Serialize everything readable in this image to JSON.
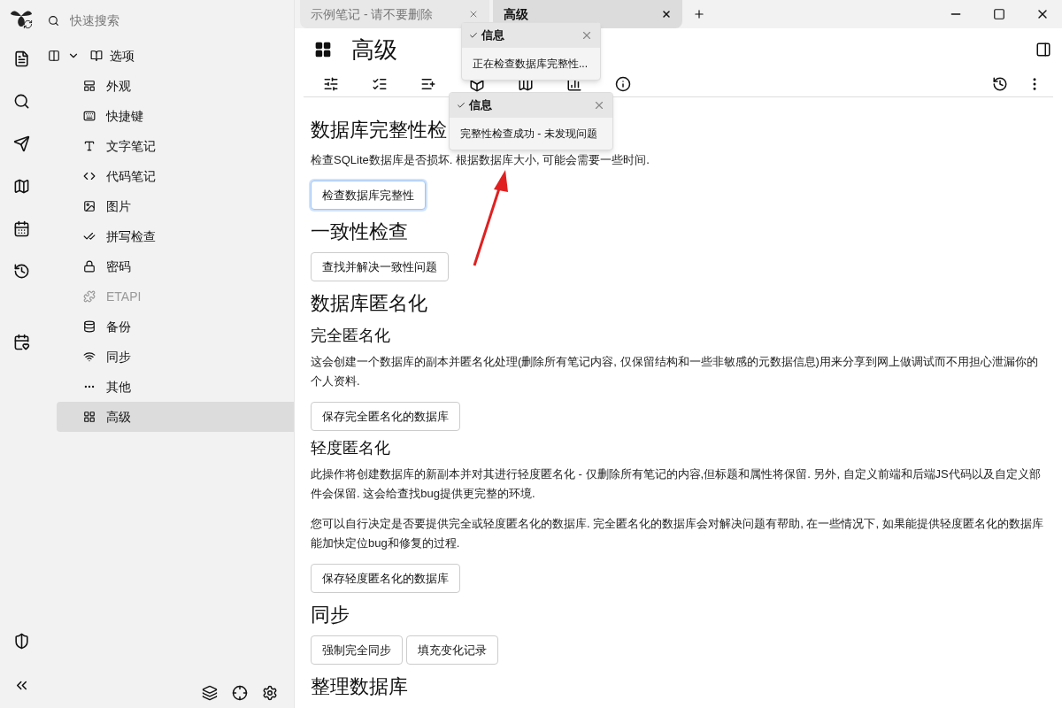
{
  "search": {
    "placeholder": "快速搜索"
  },
  "tree": {
    "label": "选项",
    "expanded": true,
    "children": [
      {
        "label": "外观",
        "selected": false,
        "disabled": false
      },
      {
        "label": "快捷键",
        "selected": false,
        "disabled": false
      },
      {
        "label": "文字笔记",
        "selected": false,
        "disabled": false
      },
      {
        "label": "代码笔记",
        "selected": false,
        "disabled": false
      },
      {
        "label": "图片",
        "selected": false,
        "disabled": false
      },
      {
        "label": "拼写检查",
        "selected": false,
        "disabled": false
      },
      {
        "label": "密码",
        "selected": false,
        "disabled": false
      },
      {
        "label": "ETAPI",
        "selected": false,
        "disabled": true
      },
      {
        "label": "备份",
        "selected": false,
        "disabled": false
      },
      {
        "label": "同步",
        "selected": false,
        "disabled": false
      },
      {
        "label": "其他",
        "selected": false,
        "disabled": false
      },
      {
        "label": "高级",
        "selected": true,
        "disabled": false
      }
    ]
  },
  "tabs": [
    {
      "label": "示例笔记 - 请不要删除",
      "selected": false
    },
    {
      "label": "高级",
      "selected": true
    }
  ],
  "note": {
    "title": "高级"
  },
  "toasts": [
    {
      "title": "信息",
      "message": "正在检查数据库完整性..."
    },
    {
      "title": "信息",
      "message": "完整性检查成功 - 未发现问题"
    }
  ],
  "sections": [
    {
      "kind": "heading",
      "text": "数据库完整性检"
    },
    {
      "kind": "paragraph",
      "text": "检查SQLite数据库是否损坏. 根据数据库大小, 可能会需要一些时间."
    },
    {
      "kind": "buttons",
      "buttons": [
        {
          "label": "检查数据库完整性",
          "focused": true
        }
      ]
    },
    {
      "kind": "heading",
      "text": "一致性检查"
    },
    {
      "kind": "buttons",
      "buttons": [
        {
          "label": "查找并解决一致性问题",
          "focused": false
        }
      ]
    },
    {
      "kind": "heading",
      "text": "数据库匿名化"
    },
    {
      "kind": "subheading",
      "text": "完全匿名化"
    },
    {
      "kind": "paragraph",
      "text": "这会创建一个数据库的副本并匿名化处理(删除所有笔记内容, 仅保留结构和一些非敏感的元数据信息)用来分享到网上做调试而不用担心泄漏你的个人资料."
    },
    {
      "kind": "buttons",
      "buttons": [
        {
          "label": "保存完全匿名化的数据库",
          "focused": false
        }
      ]
    },
    {
      "kind": "subheading",
      "text": "轻度匿名化"
    },
    {
      "kind": "paragraph",
      "text": "此操作将创建数据库的新副本并对其进行轻度匿名化 - 仅删除所有笔记的内容,但标题和属性将保留. 另外, 自定义前端和后端JS代码以及自定义部件会保留. 这会给查找bug提供更完整的环境."
    },
    {
      "kind": "paragraph",
      "text": "您可以自行决定是否要提供完全或轻度匿名化的数据库. 完全匿名化的数据库会对解决问题有帮助, 在一些情况下, 如果能提供轻度匿名化的数据库能加快定位bug和修复的过程."
    },
    {
      "kind": "buttons",
      "buttons": [
        {
          "label": "保存轻度匿名化的数据库",
          "focused": false
        }
      ]
    },
    {
      "kind": "heading",
      "text": "同步"
    },
    {
      "kind": "buttons",
      "buttons": [
        {
          "label": "强制完全同步",
          "focused": false
        },
        {
          "label": "填充变化记录",
          "focused": false
        }
      ]
    },
    {
      "kind": "heading",
      "text": "整理数据库"
    }
  ]
}
